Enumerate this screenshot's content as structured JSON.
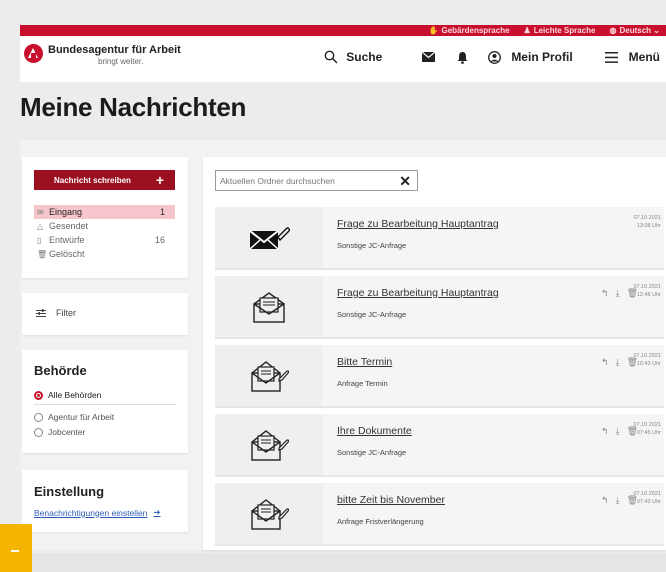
{
  "topbar": {
    "links": [
      {
        "icon": "hand-icon",
        "glyph": "✋",
        "label": "Gebärdensprache"
      },
      {
        "icon": "person-icon",
        "glyph": "♟",
        "label": "Leichte Sprache"
      },
      {
        "icon": "globe-icon",
        "glyph": "◍",
        "label": "Deutsch"
      }
    ]
  },
  "header": {
    "brand": "Bundesagentur für Arbeit",
    "tagline": "bringt weiter.",
    "search_label": "Suche",
    "profile_label": "Mein Profil",
    "menu_label": "Menü"
  },
  "page": {
    "title": "Meine Nachrichten"
  },
  "folders": {
    "write_button": "Nachricht schreiben",
    "items": [
      {
        "label": "Eingang",
        "count": "1",
        "icon": "inbox-icon"
      },
      {
        "label": "Gesendet",
        "count": "",
        "icon": "sent-icon"
      },
      {
        "label": "Entwürfe",
        "count": "16",
        "icon": "draft-icon"
      },
      {
        "label": "Gelöscht",
        "count": "",
        "icon": "trash-icon"
      }
    ]
  },
  "filter": {
    "label": "Filter"
  },
  "authority": {
    "title": "Behörde",
    "options": [
      "Alle Behörden",
      "Agentur für Arbeit",
      "Jobcenter"
    ],
    "selected": "Alle Behörden"
  },
  "settings": {
    "title": "Einstellung",
    "link": "Benachrichtigungen einstellen"
  },
  "messages_panel": {
    "search_placeholder": "Aktuellen Ordner durchsuchen",
    "messages": [
      {
        "subject": "Frage zu Bearbeitung Hauptantrag",
        "category": "Sonstige JC-Anfrage",
        "date": "07.10.2021",
        "time": "13:08 Uhr",
        "unread": true
      },
      {
        "subject": "Frage zu Bearbeitung Hauptantrag",
        "category": "Sonstige JC-Anfrage",
        "date": "07.10.2021",
        "time": "12:48 Uhr",
        "unread": false
      },
      {
        "subject": "Bitte Termin",
        "category": "Anfrage Termin",
        "date": "07.10.2021",
        "time": "10:43 Uhr",
        "unread": false
      },
      {
        "subject": "Ihre Dokumente",
        "category": "Sonstige JC-Anfrage",
        "date": "07.10.2021",
        "time": "07:45 Uhr",
        "unread": false
      },
      {
        "subject": "bitte Zeit bis November",
        "category": "Anfrage Fristverlängerung",
        "date": "07.10.2021",
        "time": "07:43 Uhr",
        "unread": false
      }
    ]
  },
  "colors": {
    "brand_red": "#c8102e",
    "button_red": "#9b1020",
    "active_folder": "#f6c6cc",
    "link_blue": "#2a5cb8",
    "accent_yellow": "#f5b400"
  }
}
